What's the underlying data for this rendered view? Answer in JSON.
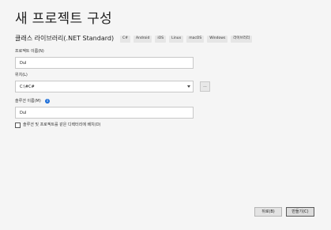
{
  "dialog": {
    "title": "새 프로젝트 구성"
  },
  "template": {
    "name": "클래스 라이브러리(.NET Standard)",
    "tags": [
      "C#",
      "Android",
      "iOS",
      "Linux",
      "macOS",
      "Windows",
      "라이브러리"
    ]
  },
  "project_name": {
    "label": "프로젝트 이름(N)",
    "value": "Dul"
  },
  "location": {
    "label": "위치(L)",
    "value": "C:\\#C#",
    "browse_label": "..."
  },
  "solution_name": {
    "label": "솔루션 이름(M)",
    "info_icon": "i",
    "value": "Dul"
  },
  "same_directory": {
    "label": "솔루션 및 프로젝트를 같은 디렉터리에 배치(D)",
    "checked": false
  },
  "buttons": {
    "back": "뒤로(B)",
    "create": "만들기(C)"
  }
}
